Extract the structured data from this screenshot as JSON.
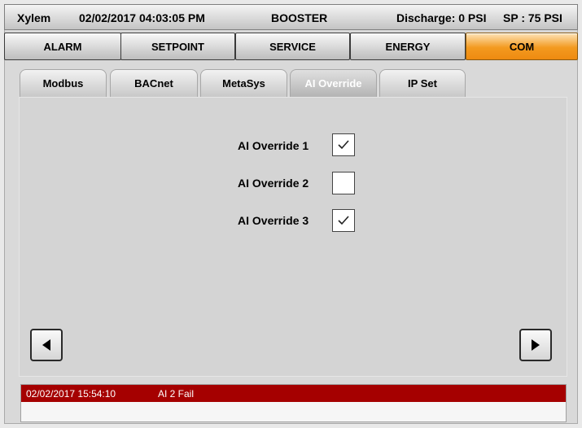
{
  "header": {
    "app_name": "Xylem",
    "datetime": "02/02/2017 04:03:05 PM",
    "mode": "BOOSTER",
    "discharge": "Discharge: 0 PSI",
    "setpoint": "SP : 75 PSI"
  },
  "main_tabs": [
    {
      "label": "ALARM",
      "active": false
    },
    {
      "label": "SETPOINT",
      "active": false
    },
    {
      "label": "SERVICE",
      "active": false
    },
    {
      "label": "ENERGY",
      "active": false
    },
    {
      "label": "COM",
      "active": true
    }
  ],
  "sub_tabs": [
    {
      "label": "Modbus",
      "active": false
    },
    {
      "label": "BACnet",
      "active": false
    },
    {
      "label": "MetaSys",
      "active": false
    },
    {
      "label": "AI Override",
      "active": true
    },
    {
      "label": "IP Set",
      "active": false
    }
  ],
  "overrides": [
    {
      "label": "AI Override 1",
      "checked": true
    },
    {
      "label": "AI Override 2",
      "checked": false
    },
    {
      "label": "AI Override 3",
      "checked": true
    }
  ],
  "alarm": {
    "timestamp": "02/02/2017 15:54:10",
    "message": "AI 2 Fail"
  },
  "colors": {
    "active_tab": "#f39a1f",
    "alarm_bar": "#a50000"
  }
}
